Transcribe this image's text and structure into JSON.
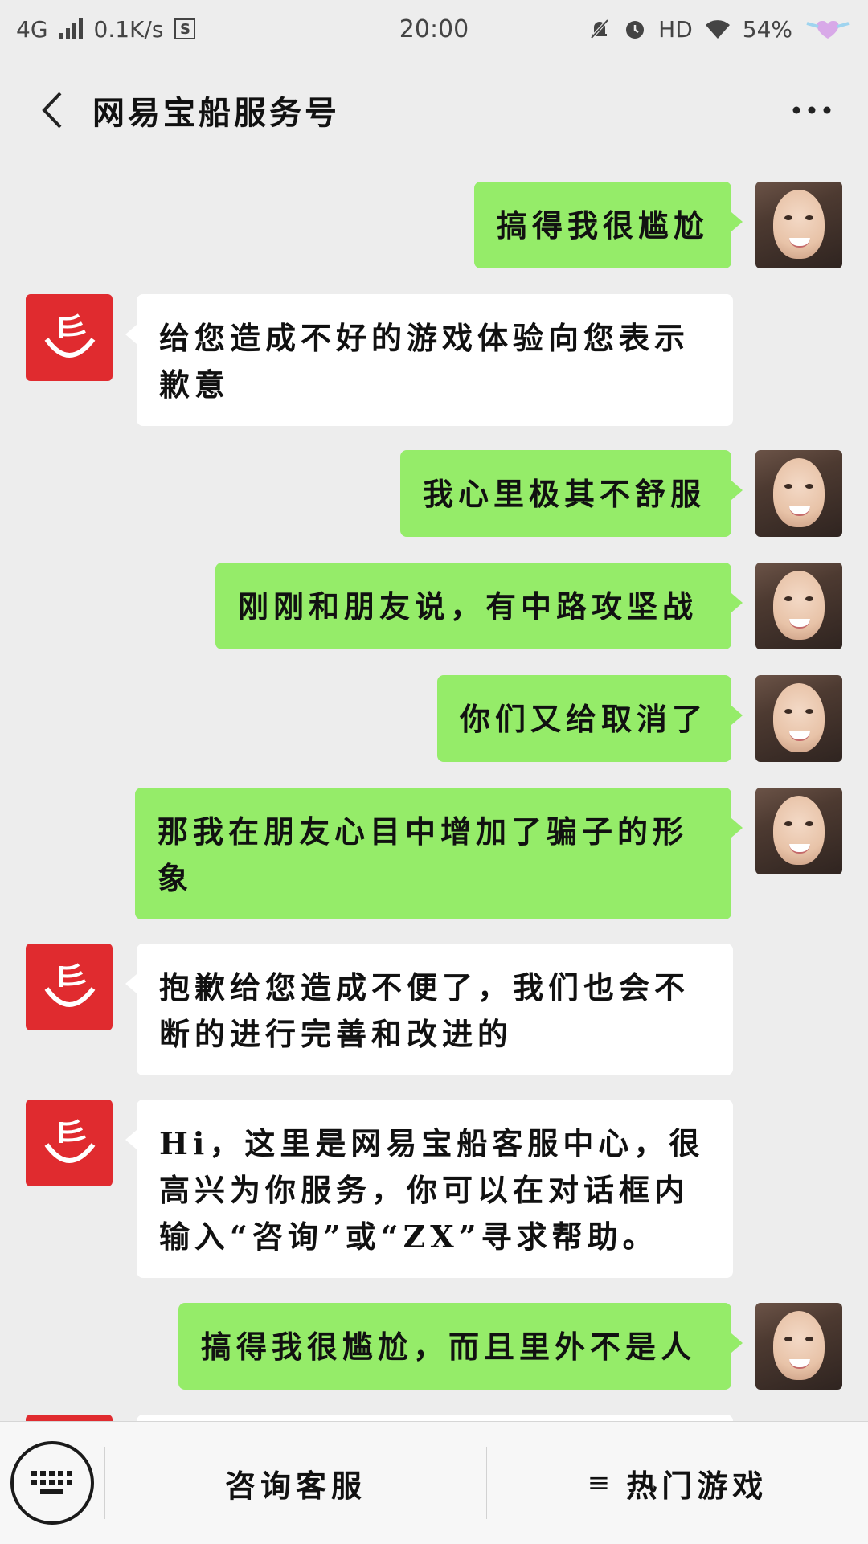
{
  "status_bar": {
    "network": "4G",
    "speed": "0.1K/s",
    "sim_badge": "S",
    "time": "20:00",
    "hd": "HD",
    "battery": "54%"
  },
  "header": {
    "title": "网易宝船服务号"
  },
  "messages": [
    {
      "from": "user",
      "text": "搞得我很尴尬"
    },
    {
      "from": "bot",
      "text": "给您造成不好的游戏体验向您表示歉意"
    },
    {
      "from": "user",
      "text": "我心里极其不舒服"
    },
    {
      "from": "user",
      "text": "刚刚和朋友说，有中路攻坚战"
    },
    {
      "from": "user",
      "text": "你们又给取消了"
    },
    {
      "from": "user",
      "text": "那我在朋友心目中增加了骗子的形象"
    },
    {
      "from": "bot",
      "text": "抱歉给您造成不便了，我们也会不断的进行完善和改进的"
    },
    {
      "from": "bot",
      "text": "Hi，这里是网易宝船客服中心，很高兴为你服务，你可以在对话框内输入“咨询”或“ZX”寻求帮助。"
    },
    {
      "from": "user",
      "text": "搞得我很尴尬，而且里外不是人"
    }
  ],
  "bottom_bar": {
    "menu_1": "咨询客服",
    "menu_2": "热门游戏",
    "menu_2_icon": "≡"
  },
  "colors": {
    "user_bubble": "#95ec69",
    "bot_bubble": "#ffffff",
    "bot_avatar": "#e02b2f",
    "background": "#ededed"
  }
}
